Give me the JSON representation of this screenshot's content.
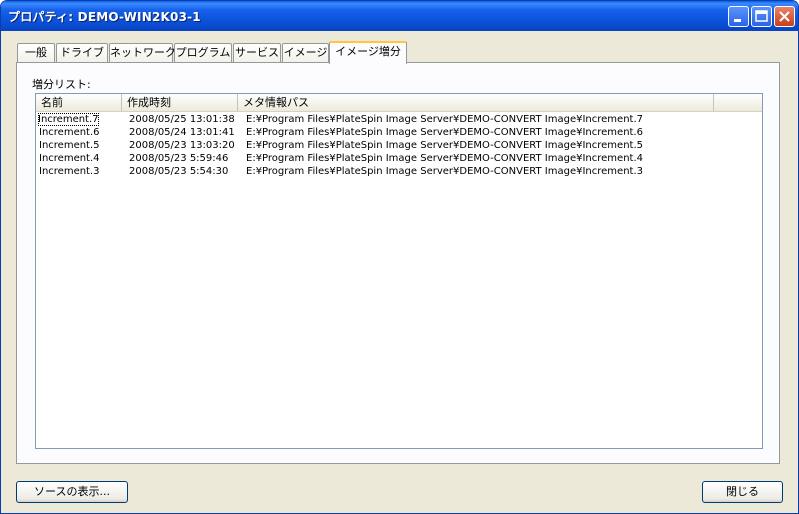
{
  "window": {
    "title": "プロパティ: DEMO-WIN2K03-1"
  },
  "tabs": [
    "一般",
    "ドライブ",
    "ネットワーク",
    "プログラム",
    "サービス",
    "イメージ",
    "イメージ増分"
  ],
  "panel": {
    "list_label": "増分リスト:",
    "columns": [
      "名前",
      "作成時刻",
      "メタ情報パス"
    ],
    "rows": [
      {
        "name": "Increment.7",
        "time": "2008/05/25 13:01:38",
        "path": "E:¥Program Files¥PlateSpin Image Server¥DEMO-CONVERT Image¥Increment.7"
      },
      {
        "name": "Increment.6",
        "time": "2008/05/24 13:01:41",
        "path": "E:¥Program Files¥PlateSpin Image Server¥DEMO-CONVERT Image¥Increment.6"
      },
      {
        "name": "Increment.5",
        "time": "2008/05/23 13:03:20",
        "path": "E:¥Program Files¥PlateSpin Image Server¥DEMO-CONVERT Image¥Increment.5"
      },
      {
        "name": "Increment.4",
        "time": "2008/05/23 5:59:46",
        "path": "E:¥Program Files¥PlateSpin Image Server¥DEMO-CONVERT Image¥Increment.4"
      },
      {
        "name": "Increment.3",
        "time": "2008/05/23 5:54:30",
        "path": "E:¥Program Files¥PlateSpin Image Server¥DEMO-CONVERT Image¥Increment.3"
      }
    ]
  },
  "buttons": {
    "show_source": "ソースの表示...",
    "close": "閉じる"
  }
}
